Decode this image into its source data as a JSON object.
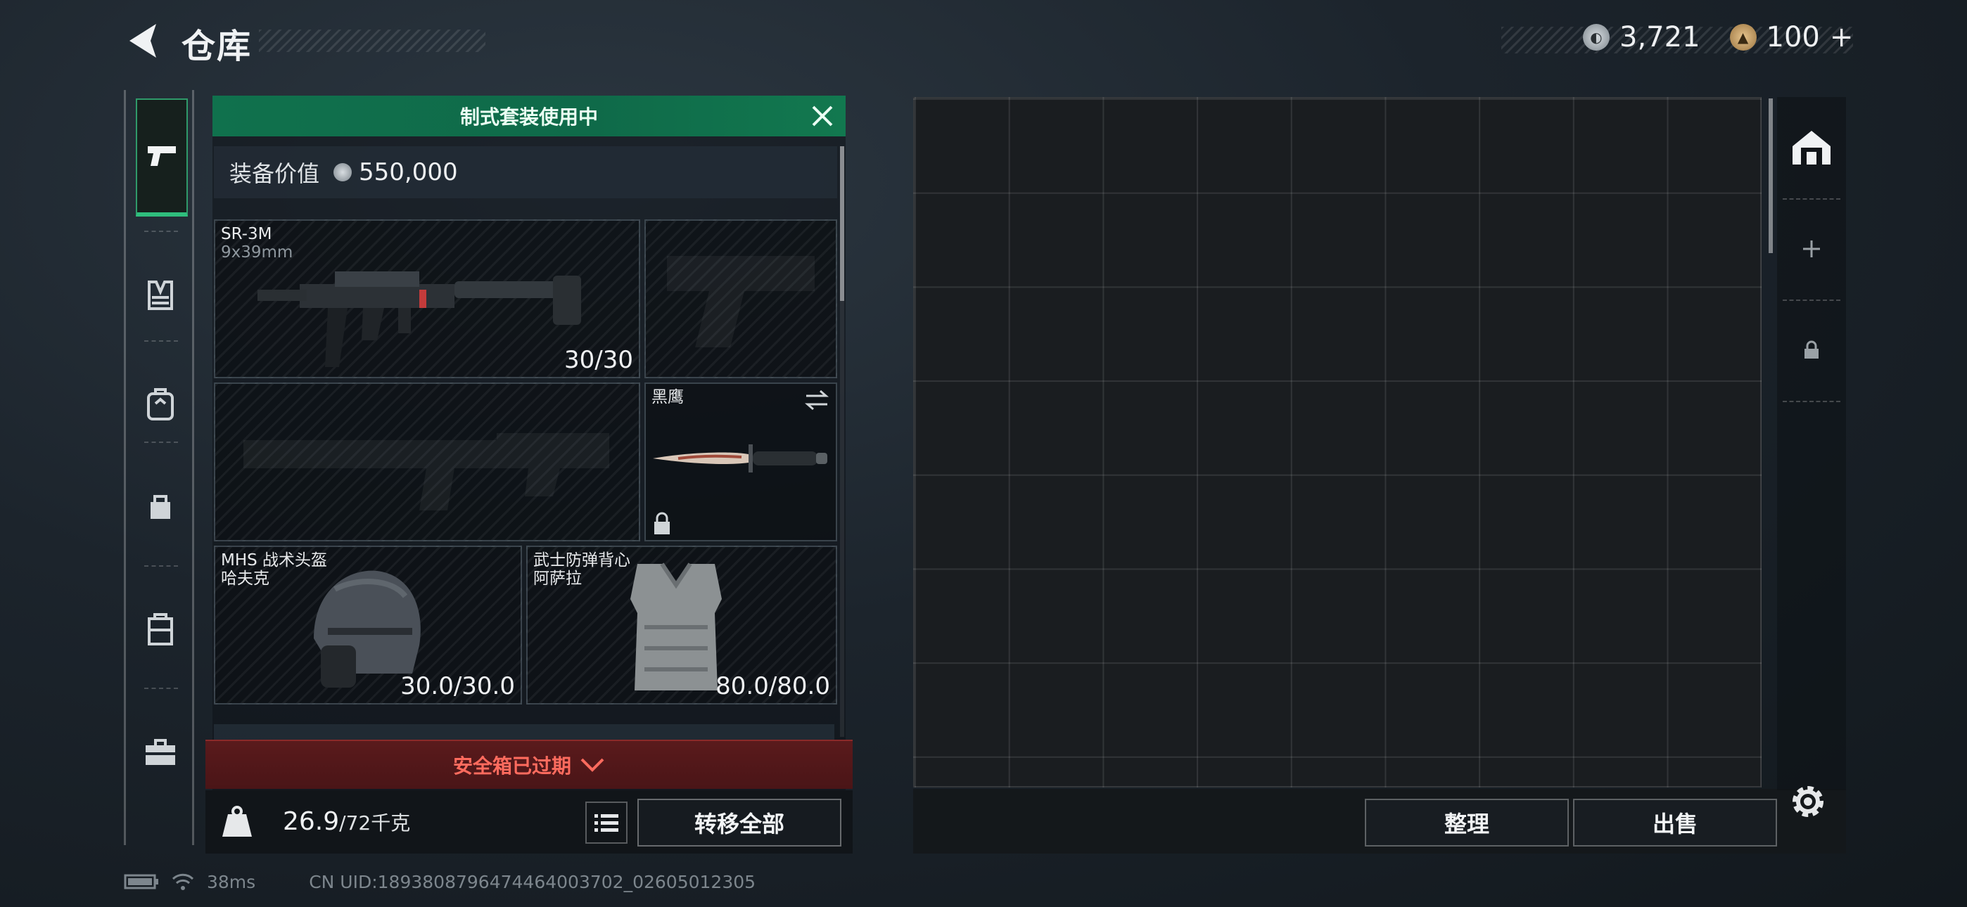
{
  "header": {
    "title": "仓库",
    "currencies": [
      {
        "name": "silver-coin-icon",
        "value": "3,721",
        "color": "#b9c0c6"
      },
      {
        "name": "gold-token-icon",
        "value": "100",
        "color": "#c8a26a"
      }
    ],
    "add_label": "+"
  },
  "side_nav": {
    "items": [
      {
        "icon": "pistol-icon",
        "active": true
      },
      {
        "icon": "chest-rig-icon",
        "active": false
      },
      {
        "icon": "backpack-icon",
        "active": false
      },
      {
        "icon": "pouch-icon",
        "active": false
      },
      {
        "icon": "case-icon",
        "active": false
      },
      {
        "icon": "toolbox-icon",
        "active": false
      }
    ]
  },
  "loadout": {
    "kit_banner": "制式套装使用中",
    "value_label": "装备价值",
    "value_amount": "550,000",
    "primary_weapon": {
      "name": "SR-3M",
      "caliber": "9x39mm",
      "ammo": "30/30"
    },
    "sidearm": {
      "empty": true
    },
    "secondary_weapon": {
      "empty": true
    },
    "melee": {
      "name": "黑鹰",
      "locked": true
    },
    "helmet": {
      "name": "MHS 战术头盔",
      "brand": "哈夫克",
      "durability": "30.0/30.0"
    },
    "armor": {
      "name": "武士防弹背心",
      "brand": "阿萨拉",
      "durability": "80.0/80.0"
    },
    "safebox_status": "安全箱已过期",
    "weight_value": "26.9",
    "weight_max": "/72千克",
    "transfer_all": "转移全部"
  },
  "storage": {
    "sort_label": "整理",
    "sell_label": "出售"
  },
  "right_rail": {
    "tabs": [
      "storage-home-icon",
      "add-tab-icon",
      "lock-icon"
    ]
  },
  "status_bar": {
    "ping": "38ms",
    "uid": "CN UID:1893808796474464003702_02605012305"
  },
  "colors": {
    "accent_green": "#12784f",
    "alert_red": "#ff6b5e"
  }
}
